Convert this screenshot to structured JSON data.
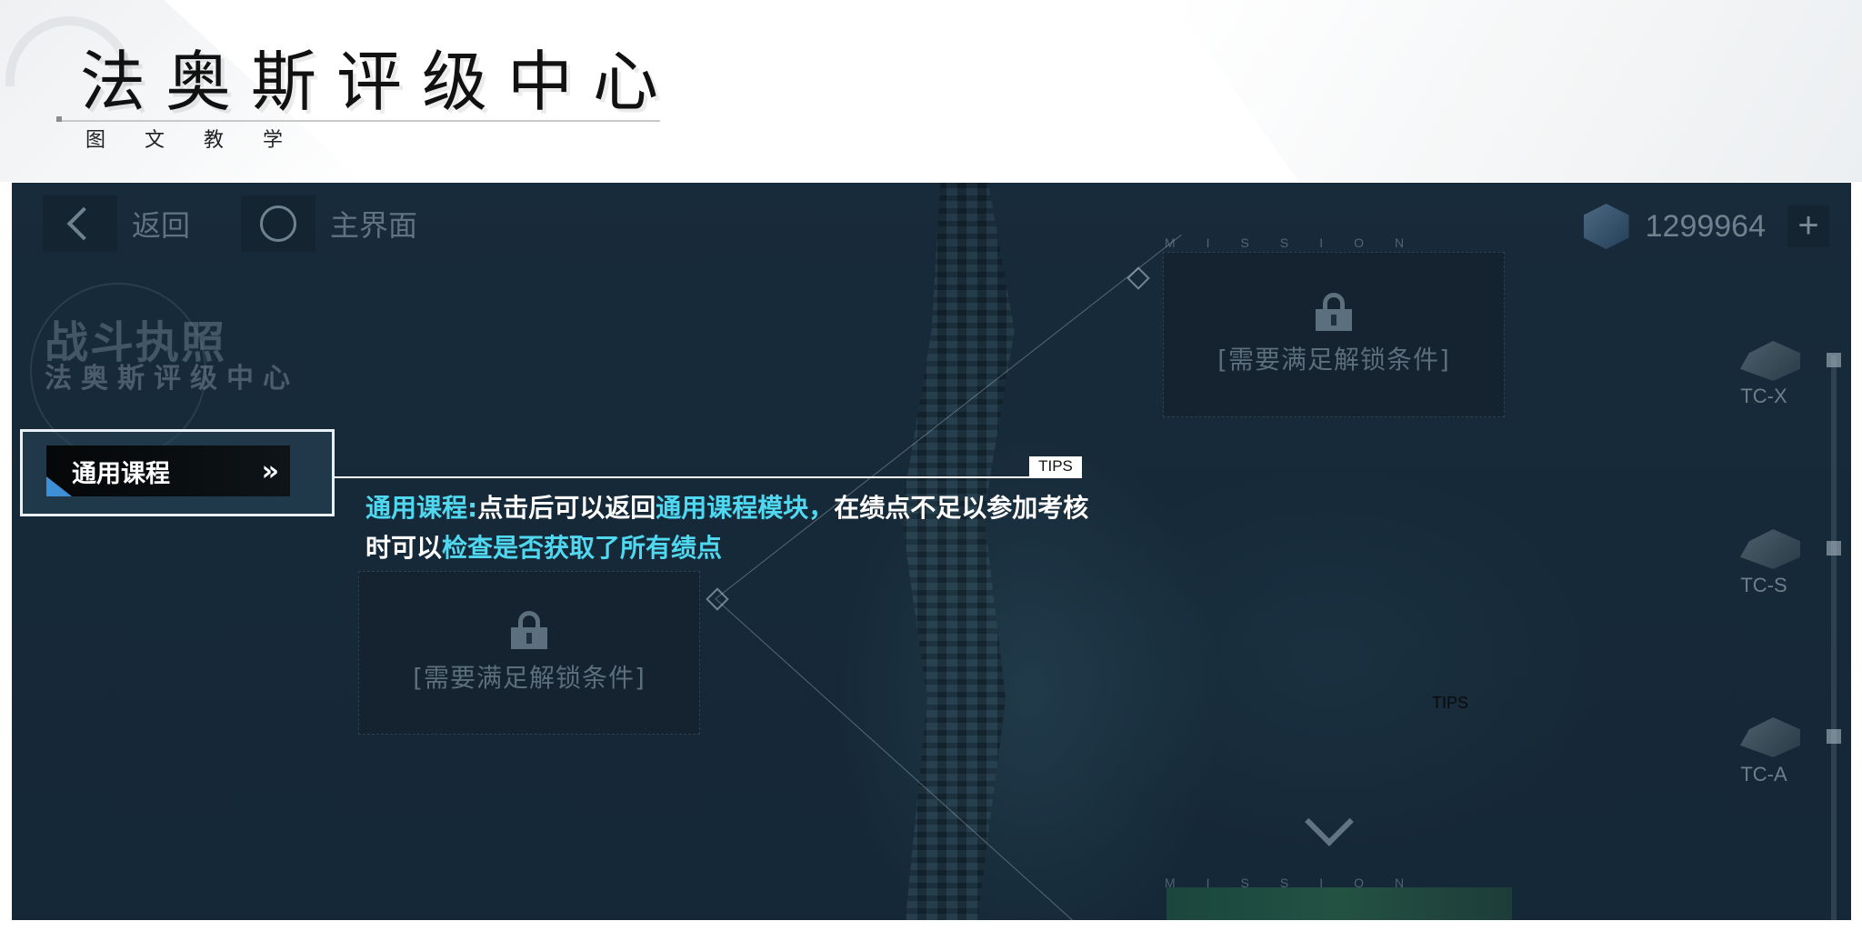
{
  "header": {
    "title": "法奥斯评级中心",
    "subtitle": "图 文 教 学"
  },
  "topbar": {
    "back_label": "返回",
    "home_label": "主界面",
    "currency_value": "1299964",
    "plus_label": "+"
  },
  "page": {
    "heading": "战斗执照",
    "subheading": "法奥斯评级中心"
  },
  "locked_cards": {
    "top_right_text": "[需要满足解锁条件]",
    "center_text": "[需要满足解锁条件]",
    "mission_label": "MISSION"
  },
  "highlight": {
    "button_label": "通用课程",
    "arrows": "»"
  },
  "tips": {
    "tag": "TIPS",
    "tag2": "TIPS",
    "part1_hl": "通用课程:",
    "part2": "点击后可以返回",
    "part3_hl": "通用课程模块，",
    "part4": "在绩点不足以参加考核时可以",
    "part5_hl": "检查是否获取了所有绩点"
  },
  "rail": {
    "items": [
      {
        "label": "TC-X"
      },
      {
        "label": "TC-S"
      },
      {
        "label": "TC-A"
      }
    ]
  },
  "icons": {
    "back": "chevron-left-icon",
    "home": "circle-icon",
    "currency": "cube-icon",
    "lock": "lock-icon",
    "scroll": "chevron-down-icon"
  },
  "colors": {
    "highlight_text": "#4fd8f0",
    "screen_bg": "#1b3142",
    "button_accent": "#3d8fd6"
  }
}
